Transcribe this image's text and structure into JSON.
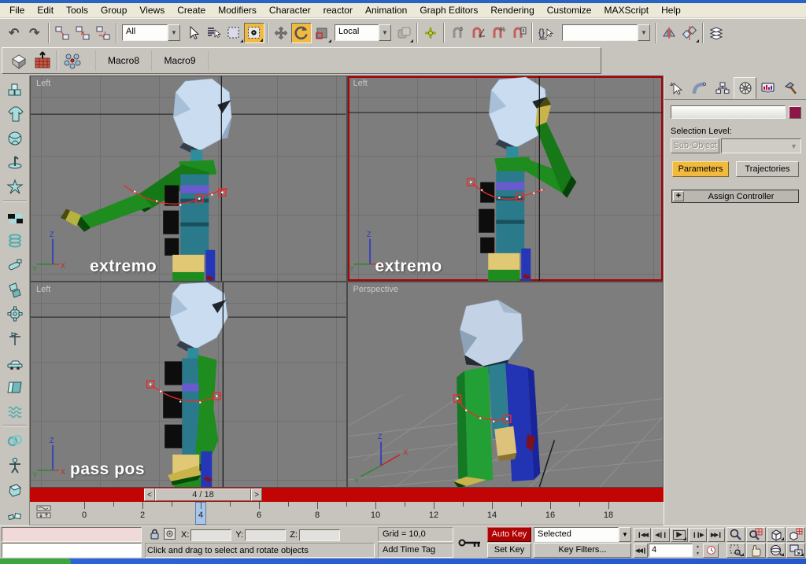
{
  "menu_bar": {
    "items": [
      "File",
      "Edit",
      "Tools",
      "Group",
      "Views",
      "Create",
      "Modifiers",
      "Character",
      "reactor",
      "Animation",
      "Graph Editors",
      "Rendering",
      "Customize",
      "MAXScript",
      "Help"
    ]
  },
  "toolbar": {
    "selection_filter_value": "All",
    "coordinate_system_value": "Local",
    "named_selection_value": "",
    "snap_badge": "3",
    "percent_badge": "%",
    "named_sets_braces": "{}",
    "named_sets_abc": "ABC",
    "buttons": [
      "undo",
      "redo",
      "|",
      "link",
      "unlink",
      "bind",
      "|",
      "filter-dd",
      "select",
      "select-by-name",
      "region",
      "window-crossing",
      "|",
      "move",
      "rotate",
      "scale",
      "coord-dd",
      "pivot",
      "|",
      "manipulate",
      "|",
      "snap",
      "angle-snap",
      "percent-snap",
      "spinner-snap",
      "|",
      "named-sets",
      "named-dd",
      "|",
      "mirror",
      "align",
      "|",
      "layers"
    ],
    "active_buttons": [
      "window-crossing",
      "rotate"
    ]
  },
  "tab_bar": {
    "tabs": [
      "Macro8",
      "Macro9"
    ]
  },
  "sidebar": {
    "icons": [
      "cubes",
      "shirt",
      "ball",
      "pin",
      "star",
      "checker",
      "spring",
      "capsule",
      "shards",
      "gear",
      "vane",
      "car",
      "pages",
      "waves",
      "knot",
      "figure",
      "cube",
      "debris"
    ],
    "dividers_after": [
      4,
      13
    ]
  },
  "viewports": [
    {
      "label": "Left",
      "annotation": "extremo"
    },
    {
      "label": "Left",
      "annotation": "extremo"
    },
    {
      "label": "Left",
      "annotation": "pass pos"
    },
    {
      "label": "Perspective",
      "annotation": ""
    }
  ],
  "axis_labels": {
    "x": "X",
    "y": "Y",
    "z": "Z"
  },
  "time_slider": {
    "value": "4 / 18",
    "prev": "<",
    "next": ">"
  },
  "track_bar": {
    "frame_min": 0,
    "frame_max": 18,
    "label_step": 2,
    "current_frame": 4
  },
  "command_panel": {
    "tabs": [
      "create",
      "modify",
      "hierarchy",
      "motion",
      "display",
      "utilities"
    ],
    "active_tab": "motion",
    "object_name_value": "",
    "object_color": "#8c1748",
    "selection_level_label": "Selection Level:",
    "sub_object_label": "Sub-Object",
    "parameters_label": "Parameters",
    "trajectories_label": "Trajectories",
    "assign_controller_label": "Assign Controller",
    "rollout_expand_glyph": "+"
  },
  "status_bar": {
    "x_label": "X:",
    "y_label": "Y:",
    "z_label": "Z:",
    "x_value": "",
    "y_value": "",
    "z_value": "",
    "grid_label": "Grid = 10,0",
    "add_time_tag_label": "Add Time Tag",
    "prompt": "Click and drag to select and rotate objects",
    "auto_key_label": "Auto Key",
    "set_key_label": "Set Key",
    "key_filter_scope_value": "Selected",
    "key_filters_label": "Key Filters...",
    "current_frame_value": "4"
  },
  "colors": {
    "active_yellow": "#f1ba3f",
    "timeline_red": "#c10505",
    "autokey_red": "#af0202",
    "viewport_bg": "#7d7d7d"
  }
}
